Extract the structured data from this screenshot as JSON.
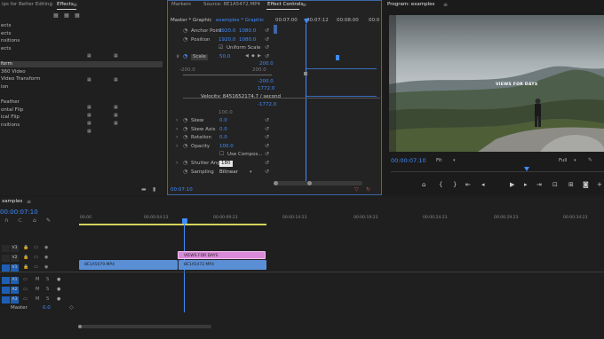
{
  "effects_panel": {
    "tab_title": "ips for Better Editing",
    "tab_effects": "Effects",
    "items": [
      "ects",
      "ects",
      "nsitions",
      "ects",
      "",
      "form",
      "360 Video",
      "Video Transform",
      "ion",
      "",
      "Feather",
      "ontal Flip",
      "ical Flip",
      "nsitions"
    ],
    "selected_index": 5
  },
  "effect_controls": {
    "tabs": [
      "Markers",
      "Source: 8E1A5472.MP4",
      "Effect Controls"
    ],
    "master": "Master * Graphic",
    "clip_ref": "examples * Graphic",
    "timecodes": [
      "00:07:00",
      "00:07:12",
      "00:08:00",
      "00:0"
    ],
    "rows": [
      {
        "label": "Anchor Point",
        "v1": "1920.0",
        "v2": "1080.0"
      },
      {
        "label": "Position",
        "v1": "1920.0",
        "v2": "1080.0"
      },
      {
        "label": "Uniform Scale",
        "v1": "",
        "v2": ""
      },
      {
        "label": "Scale",
        "v1": "50.0",
        "v2": ""
      }
    ],
    "graph": {
      "top_left": "-200.0",
      "top_right": "200.0",
      "v_200": "200.0",
      "v_1772": "1772.0",
      "v_neg200": "-200.0",
      "v_neg1772": "-1772.0",
      "velocity": "Velocity: 8451652174.7 / second"
    },
    "rows2": [
      {
        "label": "Skew",
        "v": "0.0"
      },
      {
        "label": "Skew Axis",
        "v": "0.0"
      },
      {
        "label": "Rotation",
        "v": "0.0"
      },
      {
        "label": "Opacity",
        "v": "100.0"
      },
      {
        "label": "Use Compos...",
        "v": ""
      },
      {
        "label": "Shutter Angle",
        "v": "180"
      },
      {
        "label": "Sampling",
        "v": "Bilinear"
      }
    ],
    "hidden_row": "100.0",
    "bottom_timecode": "00:07:10"
  },
  "program": {
    "title": "Program: examples",
    "overlay_text": "VIEWS FOR DAYS",
    "timecode": "00:00:07:10",
    "fit": "Fit",
    "quality": "Full",
    "end_timecode": "00:06:50:04"
  },
  "timeline": {
    "tab": "xamples",
    "timecode": "00:00:07:10",
    "ruler": [
      "00:00",
      "00:00:04:23",
      "00:00:09:23",
      "00:00:14:23",
      "00:00:19:23",
      "00:00:24:23",
      "00:00:29:23",
      "00:00:34:23"
    ],
    "tracks": [
      {
        "name": "V3",
        "lock_color": "#3a3a3a"
      },
      {
        "name": "V2",
        "lock_color": "#3a3a3a"
      },
      {
        "name": "V1",
        "lock_color": "#1e5fb3"
      },
      {
        "name": "A1",
        "lock_color": "#1e5fb3"
      },
      {
        "name": "A2",
        "lock_color": "#1e5fb3"
      },
      {
        "name": "A3",
        "lock_color": "#1e5fb3"
      }
    ],
    "master": "Master",
    "master_value": "0.0",
    "clips": {
      "graphic": "VIEWS FOR DAYS",
      "v1_a": "8E1A5079.MP4",
      "v1_b": "8E1A5472.MP4"
    }
  },
  "colors": {
    "accent": "#3f8cff",
    "clip_video": "#5a8fd6",
    "clip_graphic": "#d98ad8",
    "work_area": "#d4d45a",
    "timecode_blue": "#3f8cff"
  }
}
